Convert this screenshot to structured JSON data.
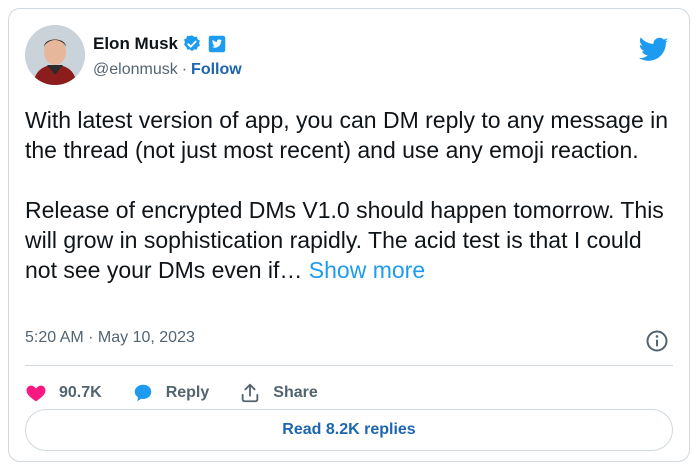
{
  "user": {
    "display_name": "Elon Musk",
    "handle": "@elonmusk",
    "separator": "·",
    "follow_label": "Follow"
  },
  "tweet": {
    "paragraph1": "With latest version of app, you can DM reply to any message in the thread (not just most recent) and use any emoji reaction.",
    "paragraph2": "Release of encrypted DMs V1.0 should happen tomorrow. This will grow in sophistication rapidly. The acid test is that I could not see your DMs even if…",
    "show_more": "Show more",
    "timestamp": "5:20 AM · May 10, 2023"
  },
  "actions": {
    "likes": "90.7K",
    "reply_label": "Reply",
    "share_label": "Share",
    "read_replies_label": "Read 8.2K replies"
  },
  "icons": {
    "logo": "twitter-bird-icon",
    "verified": "verified-badge-icon",
    "affiliate": "government-affiliation-icon",
    "info": "info-icon",
    "like": "heart-icon",
    "reply": "speech-bubble-icon",
    "share": "share-upload-icon"
  },
  "colors": {
    "brand": "#1d9bf0",
    "text": "#0f1419",
    "muted": "#536471",
    "heart": "#f91880",
    "link": "#1d65b0"
  }
}
